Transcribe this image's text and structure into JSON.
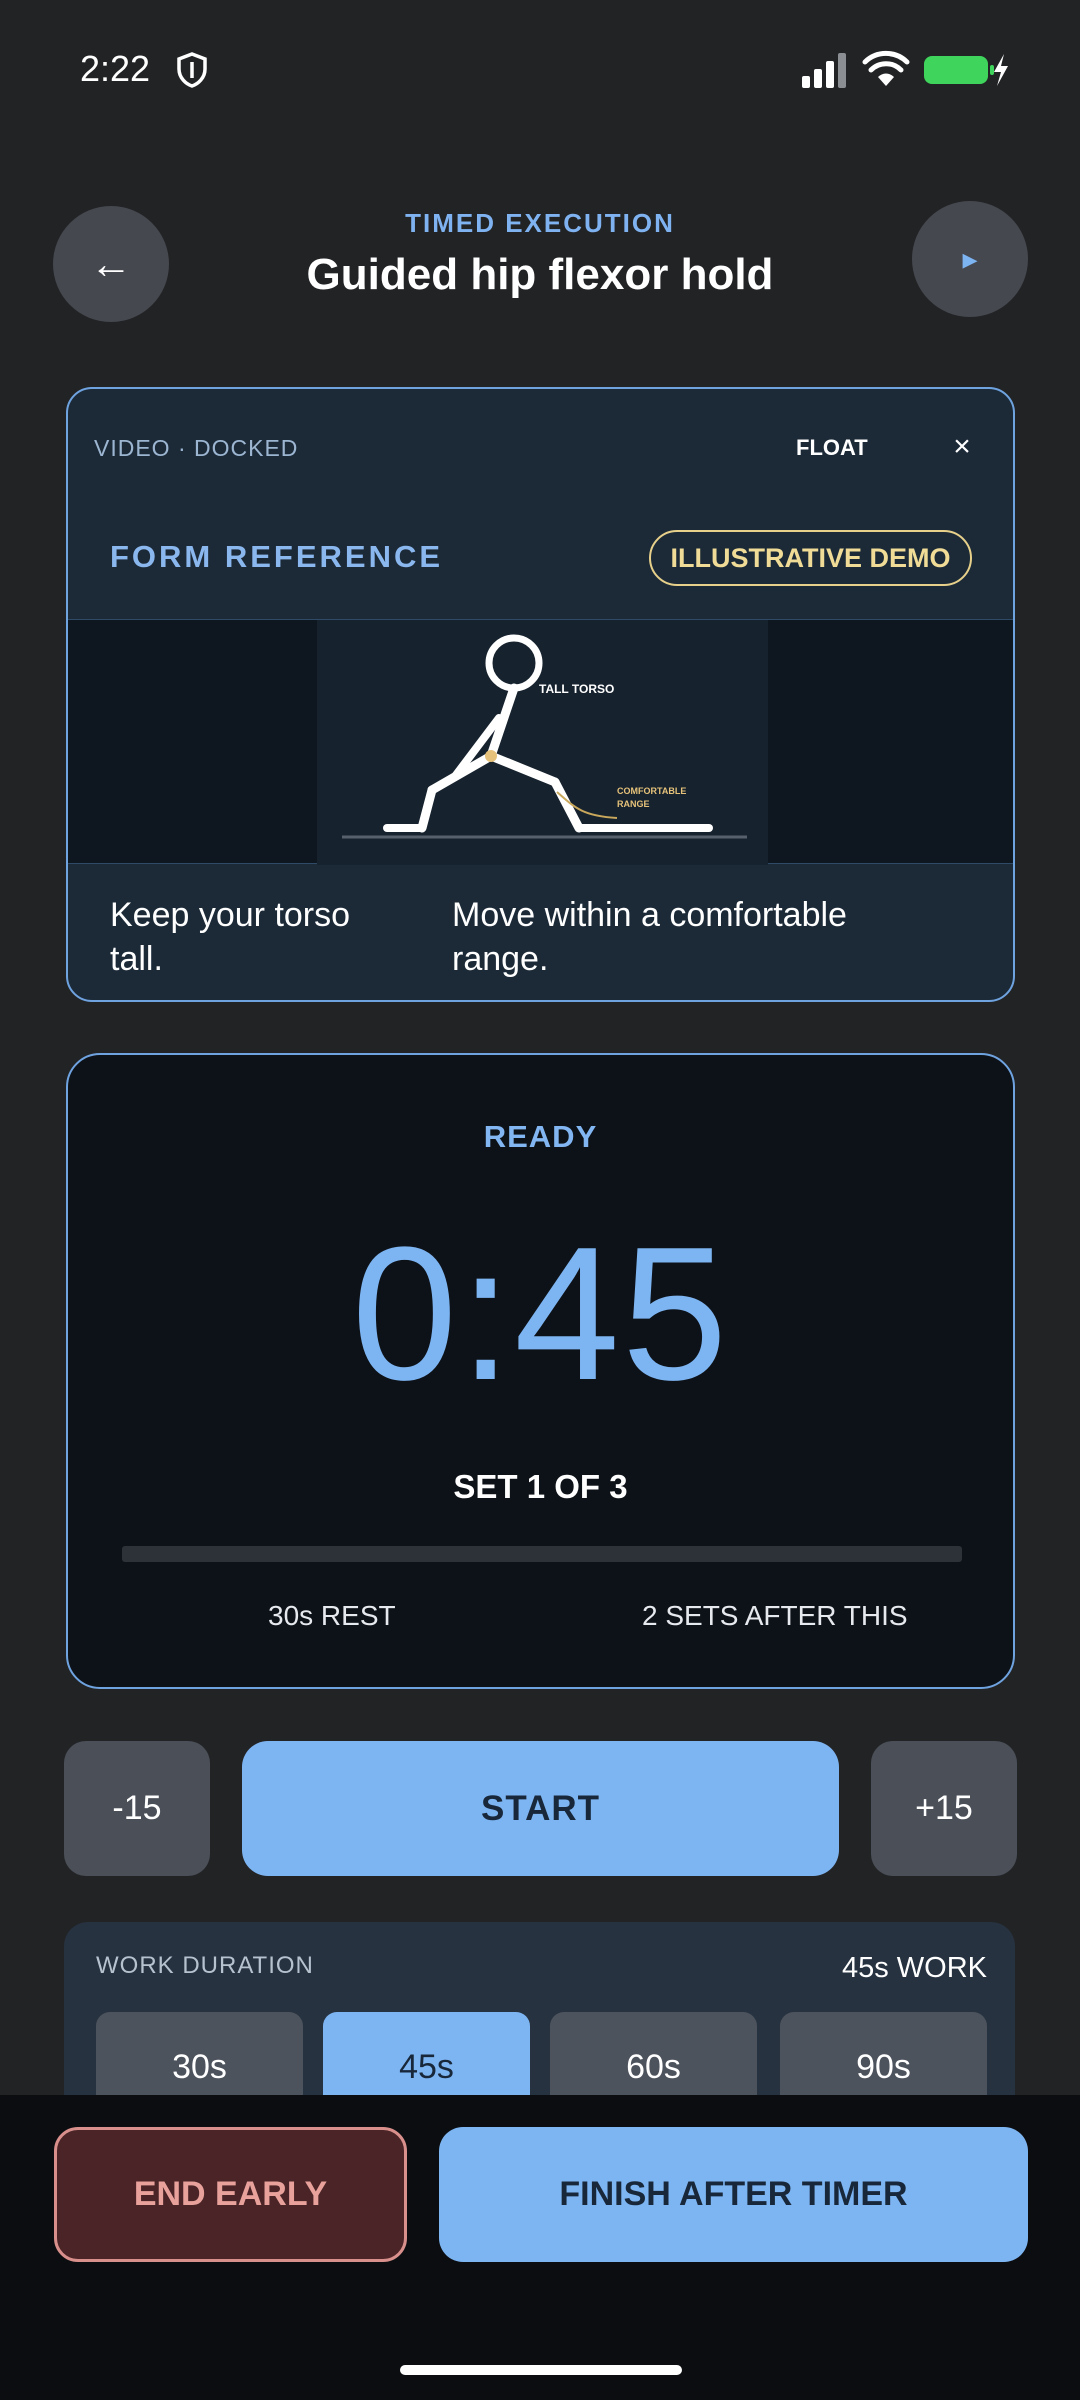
{
  "status_bar": {
    "time": "2:22",
    "icons": [
      "shield-icon",
      "signal-icon",
      "wifi-icon",
      "battery-charging-icon"
    ],
    "battery_color": "#3fd45b"
  },
  "header": {
    "eyebrow": "TIMED EXECUTION",
    "title": "Guided hip flexor hold",
    "back_icon": "←",
    "next_icon": "▸"
  },
  "video_card": {
    "mode_label": "VIDEO · DOCKED",
    "float_label": "FLOAT",
    "close_label": "×",
    "section_title": "FORM REFERENCE",
    "badge": "ILLUSTRATIVE DEMO",
    "illustration": {
      "label_torso": "TALL TORSO",
      "label_range_1": "COMFORTABLE",
      "label_range_2": "RANGE"
    },
    "captions": [
      "Keep your torso tall.",
      "Move within a comfortable range."
    ]
  },
  "timer": {
    "state": "READY",
    "time_remaining": "0:45",
    "set_label": "SET 1 OF 3",
    "progress": 0,
    "rest_label": "30s REST",
    "after_label": "2 SETS AFTER THIS"
  },
  "controls": {
    "minus_label": "-15",
    "start_label": "START",
    "plus_label": "+15"
  },
  "work_duration": {
    "label": "WORK DURATION",
    "value": "45s WORK",
    "options": [
      "30s",
      "45s",
      "60s",
      "90s"
    ],
    "selected": "45s"
  },
  "footer": {
    "end_label": "END EARLY",
    "finish_label": "FINISH AFTER TIMER"
  },
  "colors": {
    "accent": "#7db4f2",
    "background": "#222325",
    "danger": "#e8a19b",
    "badge": "#f0dc96"
  }
}
